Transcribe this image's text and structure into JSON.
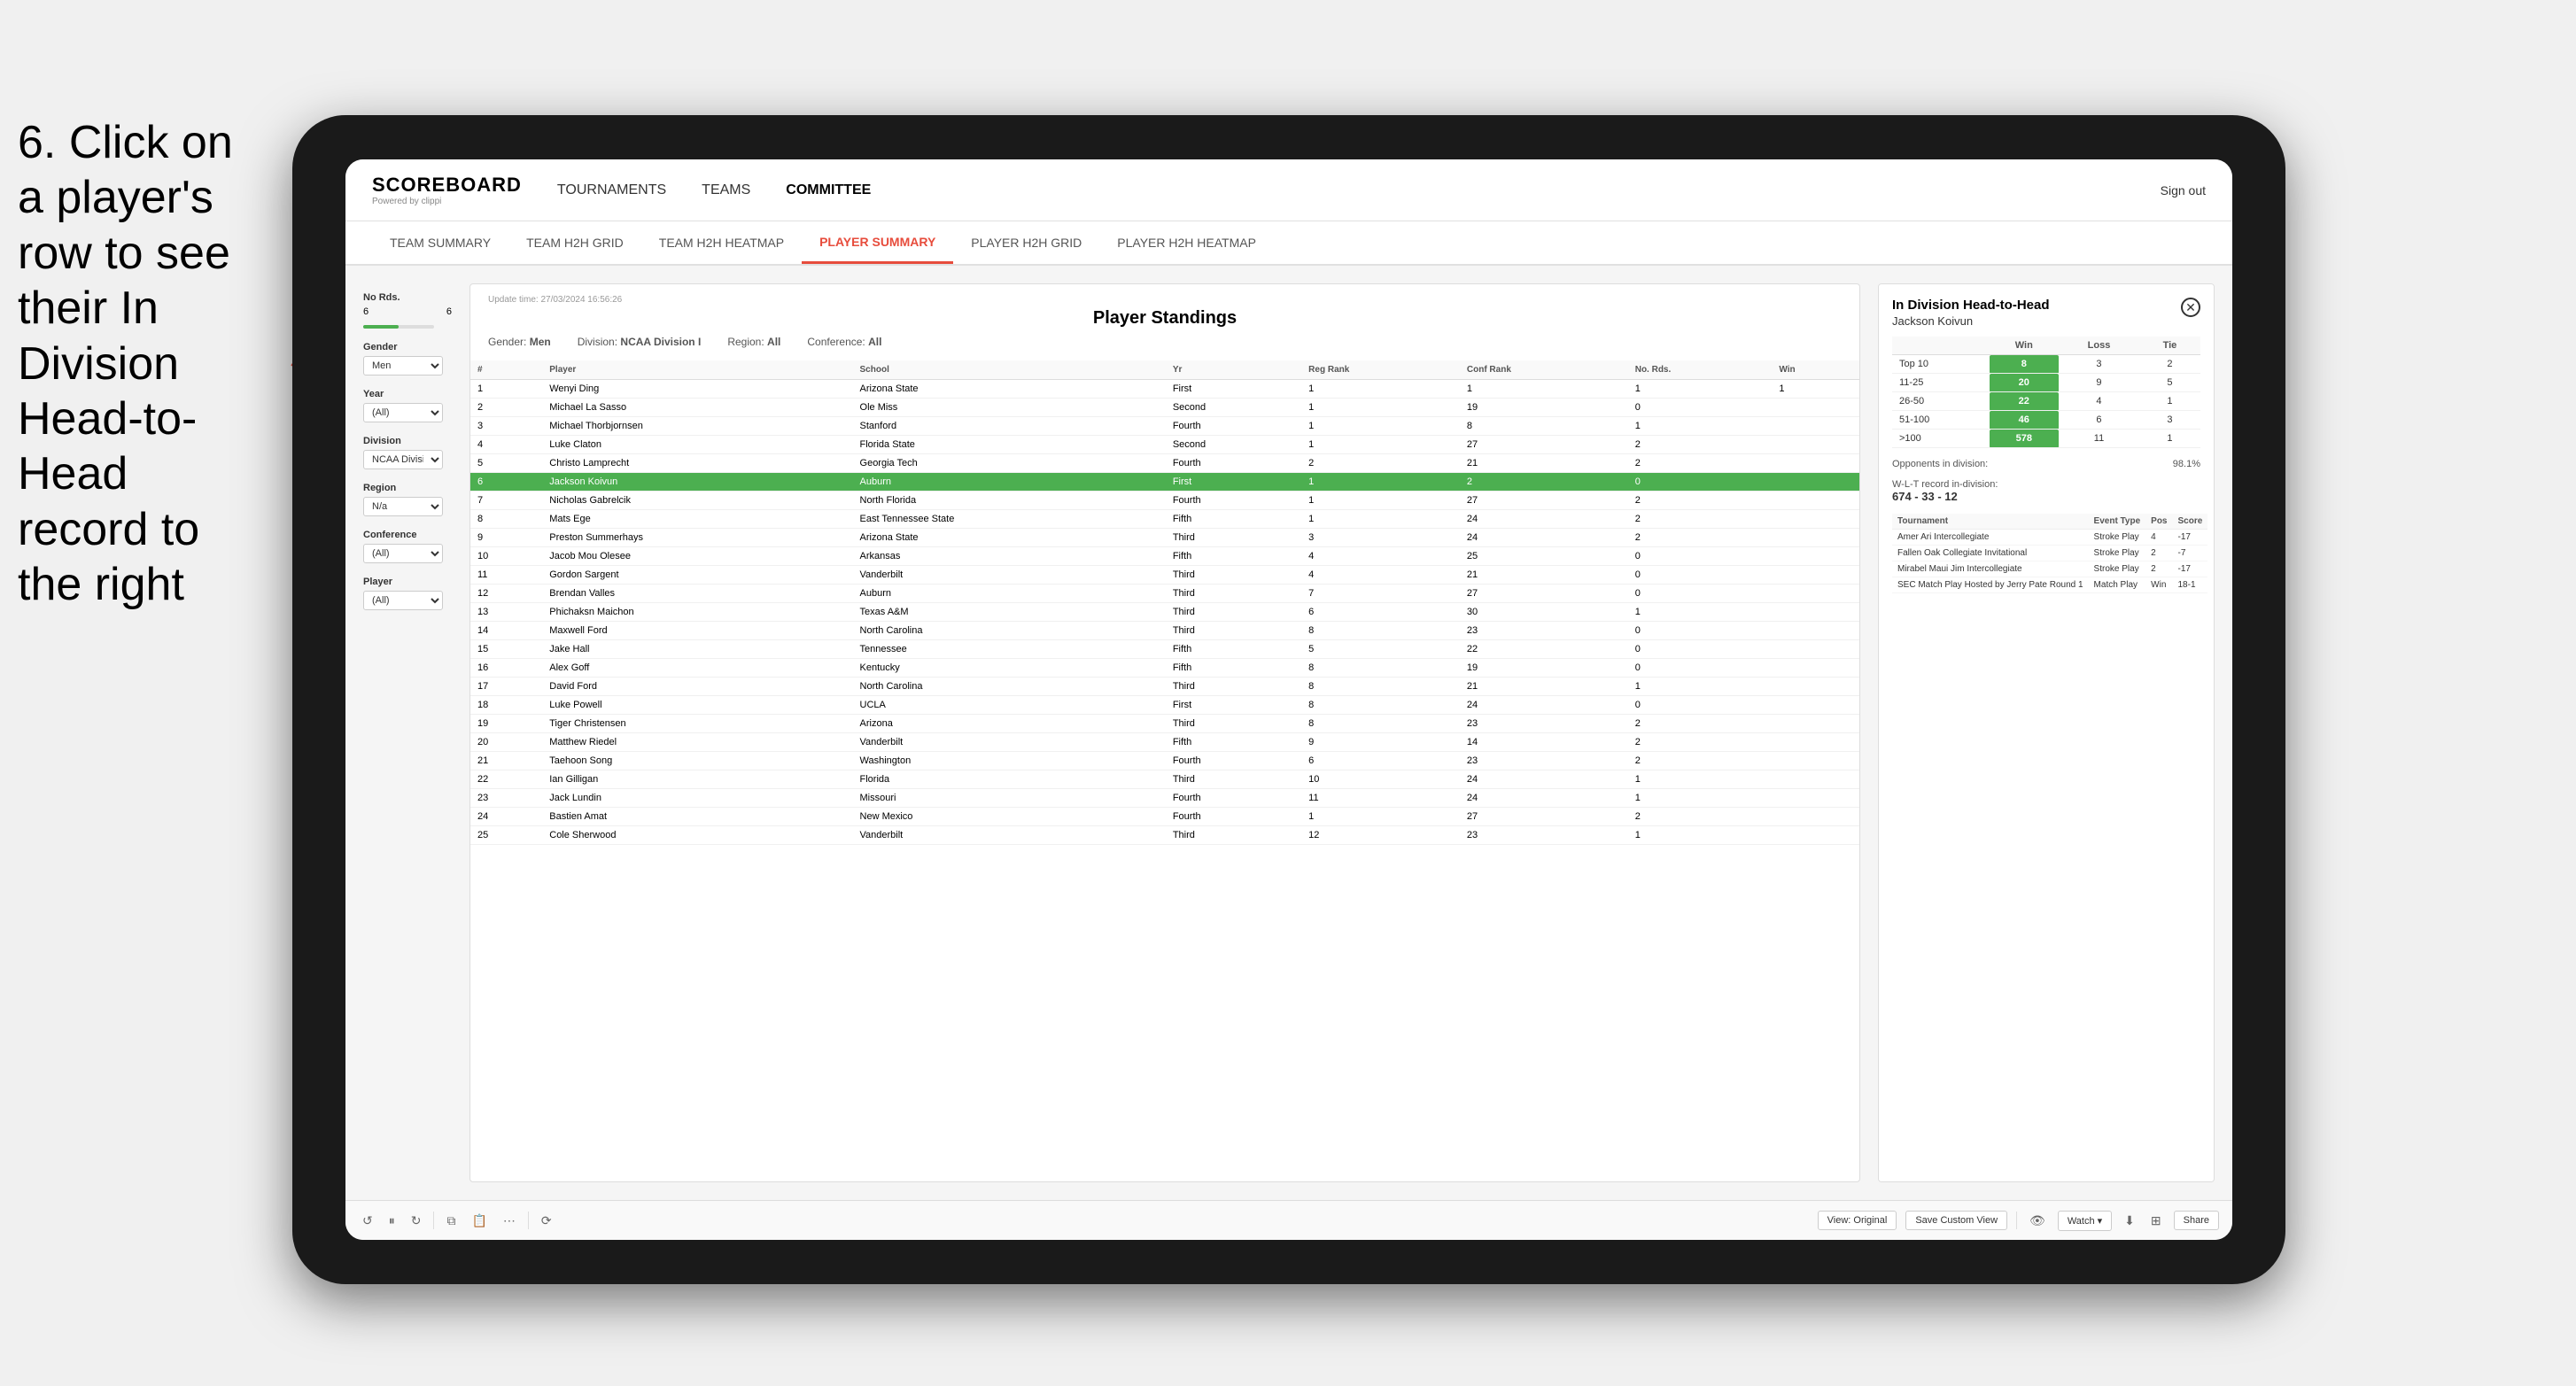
{
  "instruction": {
    "text": "6. Click on a player's row to see their In Division Head-to-Head record to the right"
  },
  "nav": {
    "logo": "SCOREBOARD",
    "logo_sub": "Powered by clippi",
    "links": [
      "TOURNAMENTS",
      "TEAMS",
      "COMMITTEE"
    ],
    "sign_out": "Sign out"
  },
  "sub_nav": {
    "links": [
      "TEAM SUMMARY",
      "TEAM H2H GRID",
      "TEAM H2H HEATMAP",
      "PLAYER SUMMARY",
      "PLAYER H2H GRID",
      "PLAYER H2H HEATMAP"
    ],
    "active": "PLAYER SUMMARY"
  },
  "update_time": "Update time: 27/03/2024 16:56:26",
  "standings": {
    "title": "Player Standings",
    "gender_label": "Gender:",
    "gender_value": "Men",
    "division_label": "Division:",
    "division_value": "NCAA Division I",
    "region_label": "Region:",
    "region_value": "All",
    "conference_label": "Conference:",
    "conference_value": "All",
    "columns": [
      "#",
      "Player",
      "School",
      "Yr",
      "Reg Rank",
      "Conf Rank",
      "No. Rds.",
      "Win"
    ],
    "rows": [
      {
        "num": 1,
        "player": "Wenyi Ding",
        "school": "Arizona State",
        "yr": "First",
        "reg": 1,
        "conf": 1,
        "rds": 1,
        "win": 1
      },
      {
        "num": 2,
        "player": "Michael La Sasso",
        "school": "Ole Miss",
        "yr": "Second",
        "reg": 1,
        "conf": 19,
        "rds": 0
      },
      {
        "num": 3,
        "player": "Michael Thorbjornsen",
        "school": "Stanford",
        "yr": "Fourth",
        "reg": 1,
        "conf": 8,
        "rds": 1
      },
      {
        "num": 4,
        "player": "Luke Claton",
        "school": "Florida State",
        "yr": "Second",
        "reg": 1,
        "conf": 27,
        "rds": 2
      },
      {
        "num": 5,
        "player": "Christo Lamprecht",
        "school": "Georgia Tech",
        "yr": "Fourth",
        "reg": 2,
        "conf": 21,
        "rds": 2
      },
      {
        "num": 6,
        "player": "Jackson Koivun",
        "school": "Auburn",
        "yr": "First",
        "reg": 1,
        "conf": 2,
        "rds": 0,
        "selected": true
      },
      {
        "num": 7,
        "player": "Nicholas Gabrelcik",
        "school": "North Florida",
        "yr": "Fourth",
        "reg": 1,
        "conf": 27,
        "rds": 2
      },
      {
        "num": 8,
        "player": "Mats Ege",
        "school": "East Tennessee State",
        "yr": "Fifth",
        "reg": 1,
        "conf": 24,
        "rds": 2
      },
      {
        "num": 9,
        "player": "Preston Summerhays",
        "school": "Arizona State",
        "yr": "Third",
        "reg": 3,
        "conf": 24,
        "rds": 2
      },
      {
        "num": 10,
        "player": "Jacob Mou Olesee",
        "school": "Arkansas",
        "yr": "Fifth",
        "reg": 4,
        "conf": 25,
        "rds": 0
      },
      {
        "num": 11,
        "player": "Gordon Sargent",
        "school": "Vanderbilt",
        "yr": "Third",
        "reg": 4,
        "conf": 21,
        "rds": 0
      },
      {
        "num": 12,
        "player": "Brendan Valles",
        "school": "Auburn",
        "yr": "Third",
        "reg": 7,
        "conf": 27,
        "rds": 0
      },
      {
        "num": 13,
        "player": "Phichaksn Maichon",
        "school": "Texas A&M",
        "yr": "Third",
        "reg": 6,
        "conf": 30,
        "rds": 1
      },
      {
        "num": 14,
        "player": "Maxwell Ford",
        "school": "North Carolina",
        "yr": "Third",
        "reg": 8,
        "conf": 23,
        "rds": 0
      },
      {
        "num": 15,
        "player": "Jake Hall",
        "school": "Tennessee",
        "yr": "Fifth",
        "reg": 5,
        "conf": 22,
        "rds": 0
      },
      {
        "num": 16,
        "player": "Alex Goff",
        "school": "Kentucky",
        "yr": "Fifth",
        "reg": 8,
        "conf": 19,
        "rds": 0
      },
      {
        "num": 17,
        "player": "David Ford",
        "school": "North Carolina",
        "yr": "Third",
        "reg": 8,
        "conf": 21,
        "rds": 1
      },
      {
        "num": 18,
        "player": "Luke Powell",
        "school": "UCLA",
        "yr": "First",
        "reg": 8,
        "conf": 24,
        "rds": 0
      },
      {
        "num": 19,
        "player": "Tiger Christensen",
        "school": "Arizona",
        "yr": "Third",
        "reg": 8,
        "conf": 23,
        "rds": 2
      },
      {
        "num": 20,
        "player": "Matthew Riedel",
        "school": "Vanderbilt",
        "yr": "Fifth",
        "reg": 9,
        "conf": 14,
        "rds": 2
      },
      {
        "num": 21,
        "player": "Taehoon Song",
        "school": "Washington",
        "yr": "Fourth",
        "reg": 6,
        "conf": 23,
        "rds": 2
      },
      {
        "num": 22,
        "player": "Ian Gilligan",
        "school": "Florida",
        "yr": "Third",
        "reg": 10,
        "conf": 24,
        "rds": 1
      },
      {
        "num": 23,
        "player": "Jack Lundin",
        "school": "Missouri",
        "yr": "Fourth",
        "reg": 11,
        "conf": 24,
        "rds": 1
      },
      {
        "num": 24,
        "player": "Bastien Amat",
        "school": "New Mexico",
        "yr": "Fourth",
        "reg": 1,
        "conf": 27,
        "rds": 2
      },
      {
        "num": 25,
        "player": "Cole Sherwood",
        "school": "Vanderbilt",
        "yr": "Third",
        "reg": 12,
        "conf": 23,
        "rds": 1
      }
    ]
  },
  "sidebar": {
    "no_rds_label": "No Rds.",
    "no_rds_value": "6",
    "no_rds_sub": "6",
    "gender_label": "Gender",
    "gender_value": "Men",
    "year_label": "Year",
    "year_value": "(All)",
    "division_label": "Division",
    "division_value": "NCAA Division I",
    "region_label": "Region",
    "region_value": "N/a",
    "conference_label": "Conference",
    "conference_value": "(All)",
    "player_label": "Player",
    "player_value": "(All)"
  },
  "h2h": {
    "title": "In Division Head-to-Head",
    "player": "Jackson Koivun",
    "columns": [
      "Win",
      "Loss",
      "Tie"
    ],
    "rows": [
      {
        "rank": "Top 10",
        "win": 8,
        "loss": 3,
        "tie": 2
      },
      {
        "rank": "11-25",
        "win": 20,
        "loss": 9,
        "tie": 5
      },
      {
        "rank": "26-50",
        "win": 22,
        "loss": 4,
        "tie": 1
      },
      {
        "rank": "51-100",
        "win": 46,
        "loss": 6,
        "tie": 3
      },
      {
        "rank": ">100",
        "win": 578,
        "loss": 11,
        "tie": 1
      }
    ],
    "opponents_label": "Opponents in division:",
    "opponents_pct": "98.1%",
    "wlt_label": "W-L-T record in-division:",
    "wlt_value": "674 - 33 - 12",
    "tournament_columns": [
      "Tournament",
      "Event Type",
      "Pos",
      "Score"
    ],
    "tournaments": [
      {
        "name": "Amer Ari Intercollegiate",
        "type": "Stroke Play",
        "pos": 4,
        "score": "-17"
      },
      {
        "name": "Fallen Oak Collegiate Invitational",
        "type": "Stroke Play",
        "pos": 2,
        "score": "-7"
      },
      {
        "name": "Mirabel Maui Jim Intercollegiate",
        "type": "Stroke Play",
        "pos": 2,
        "score": "-17"
      },
      {
        "name": "SEC Match Play Hosted by Jerry Pate Round 1",
        "type": "Match Play",
        "pos": "Win",
        "score": "18-1"
      }
    ]
  },
  "toolbar": {
    "view_original": "View: Original",
    "save_custom": "Save Custom View",
    "watch": "Watch ▾",
    "share": "Share"
  }
}
